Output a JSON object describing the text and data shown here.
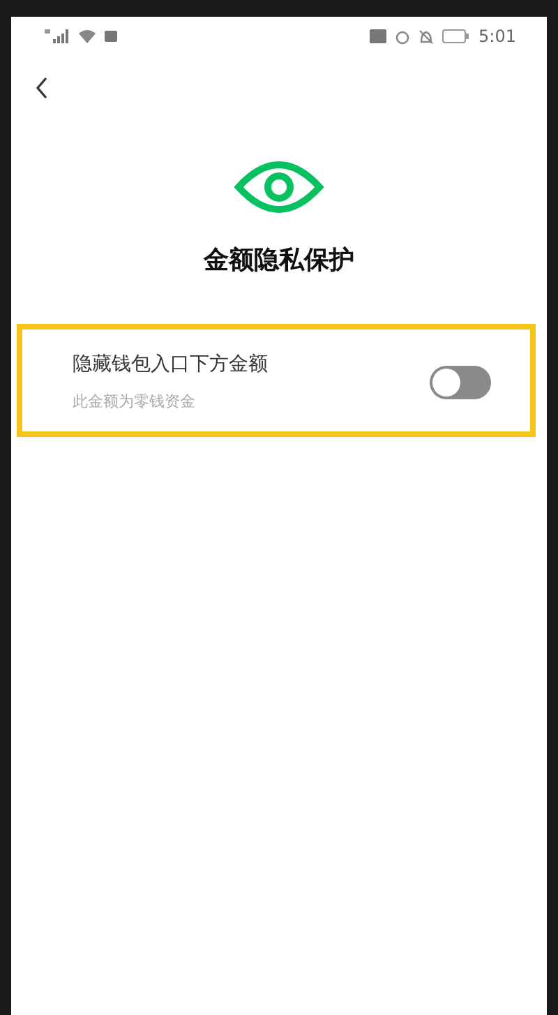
{
  "status_bar": {
    "time": "5:01"
  },
  "header": {
    "title": "金额隐私保护"
  },
  "setting": {
    "label": "隐藏钱包入口下方金额",
    "description": "此金额为零钱资金",
    "on": false
  }
}
